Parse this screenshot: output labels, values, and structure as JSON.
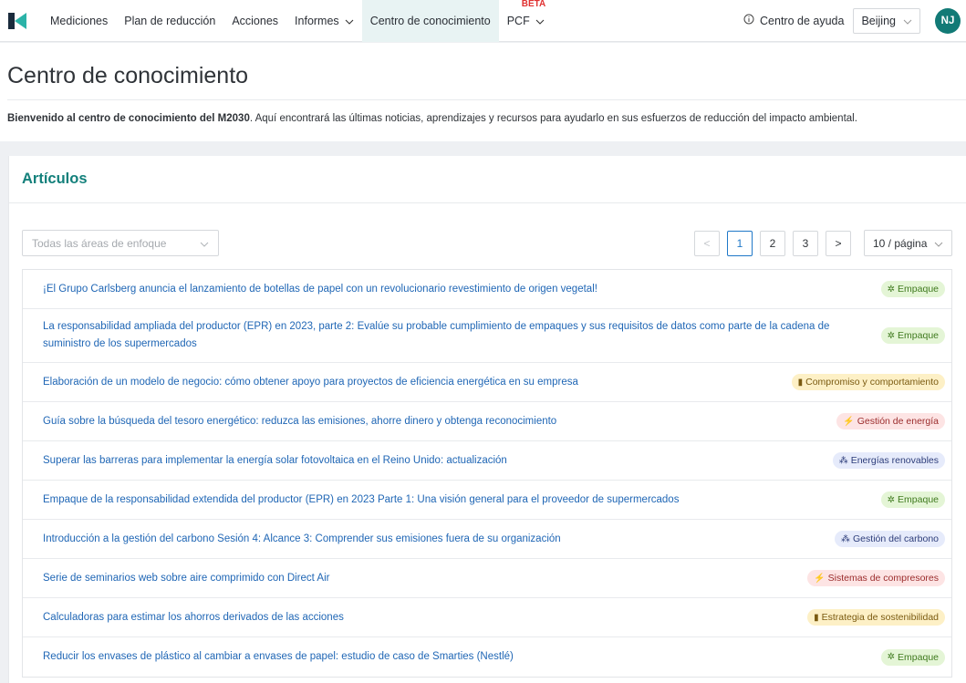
{
  "nav": {
    "items": [
      {
        "label": "Mediciones",
        "has_chevron": false,
        "active": false
      },
      {
        "label": "Plan de reducción",
        "has_chevron": false,
        "active": false
      },
      {
        "label": "Acciones",
        "has_chevron": false,
        "active": false
      },
      {
        "label": "Informes",
        "has_chevron": true,
        "active": false
      },
      {
        "label": "Centro de conocimiento",
        "has_chevron": false,
        "active": true
      },
      {
        "label": "PCF",
        "has_chevron": true,
        "active": false,
        "badge": "BETA"
      }
    ],
    "help_label": "Centro de ayuda",
    "city": "Beijing",
    "avatar_initials": "NJ"
  },
  "page": {
    "title": "Centro de conocimiento",
    "welcome_bold": "Bienvenido al centro de conocimiento del M2030",
    "welcome_rest": ". Aquí encontrará las últimas noticias, aprendizajes y recursos para ayudarlo en sus esfuerzos de reducción del impacto ambiental."
  },
  "articles": {
    "title": "Artículos",
    "filter_placeholder": "Todas las áreas de enfoque",
    "pagination": {
      "prev": "<",
      "pages": [
        "1",
        "2",
        "3"
      ],
      "current": "1",
      "next": ">",
      "per_page": "10 / página"
    },
    "rows": [
      {
        "title": "¡El Grupo Carlsberg anuncia el lanzamiento de botellas de papel con un revolucionario revestimiento de origen vegetal!",
        "tag": "Empaque",
        "tag_icon": "✲",
        "tag_color": "#e4f5d6",
        "tag_text": "#3f7a1e"
      },
      {
        "title": "La responsabilidad ampliada del productor (EPR) en 2023, parte 2: Evalúe su probable cumplimiento de empaques y sus requisitos de datos como parte de la cadena de suministro de los supermercados",
        "tag": "Empaque",
        "tag_icon": "✲",
        "tag_color": "#e4f5d6",
        "tag_text": "#3f7a1e"
      },
      {
        "title": "Elaboración de un modelo de negocio: cómo obtener apoyo para proyectos de eficiencia energética en su empresa",
        "tag": "Compromiso y comportamiento",
        "tag_icon": "▮",
        "tag_color": "#fdf0c6",
        "tag_text": "#7a5a10"
      },
      {
        "title": "Guía sobre la búsqueda del tesoro energético: reduzca las emisiones, ahorre dinero y obtenga reconocimiento",
        "tag": "Gestión de energía",
        "tag_icon": "⚡",
        "tag_color": "#fde4e4",
        "tag_text": "#9b2c2c"
      },
      {
        "title": "Superar las barreras para implementar la energía solar fotovoltaica en el Reino Unido: actualización",
        "tag": "Energías renovables",
        "tag_icon": "⁂",
        "tag_color": "#e6ebfb",
        "tag_text": "#2d3d7a"
      },
      {
        "title": "Empaque de la responsabilidad extendida del productor (EPR) en 2023 Parte 1: Una visión general para el proveedor de supermercados",
        "tag": "Empaque",
        "tag_icon": "✲",
        "tag_color": "#e4f5d6",
        "tag_text": "#3f7a1e"
      },
      {
        "title": "Introducción a la gestión del carbono Sesión 4: Alcance 3: Comprender sus emisiones fuera de su organización",
        "tag": "Gestión del carbono",
        "tag_icon": "⁂",
        "tag_color": "#e6ebfb",
        "tag_text": "#2d3d7a"
      },
      {
        "title": "Serie de seminarios web sobre aire comprimido con Direct Air",
        "tag": "Sistemas de compresores",
        "tag_icon": "⚡",
        "tag_color": "#fde4e4",
        "tag_text": "#9b2c2c"
      },
      {
        "title": "Calculadoras para estimar los ahorros derivados de las acciones",
        "tag": "Estrategia de sostenibilidad",
        "tag_icon": "▮",
        "tag_color": "#fdf0c6",
        "tag_text": "#7a5a10"
      },
      {
        "title": "Reducir los envases de plástico al cambiar a envases de papel: estudio de caso de Smarties (Nestlé)",
        "tag": "Empaque",
        "tag_icon": "✲",
        "tag_color": "#e4f5d6",
        "tag_text": "#3f7a1e"
      }
    ]
  }
}
